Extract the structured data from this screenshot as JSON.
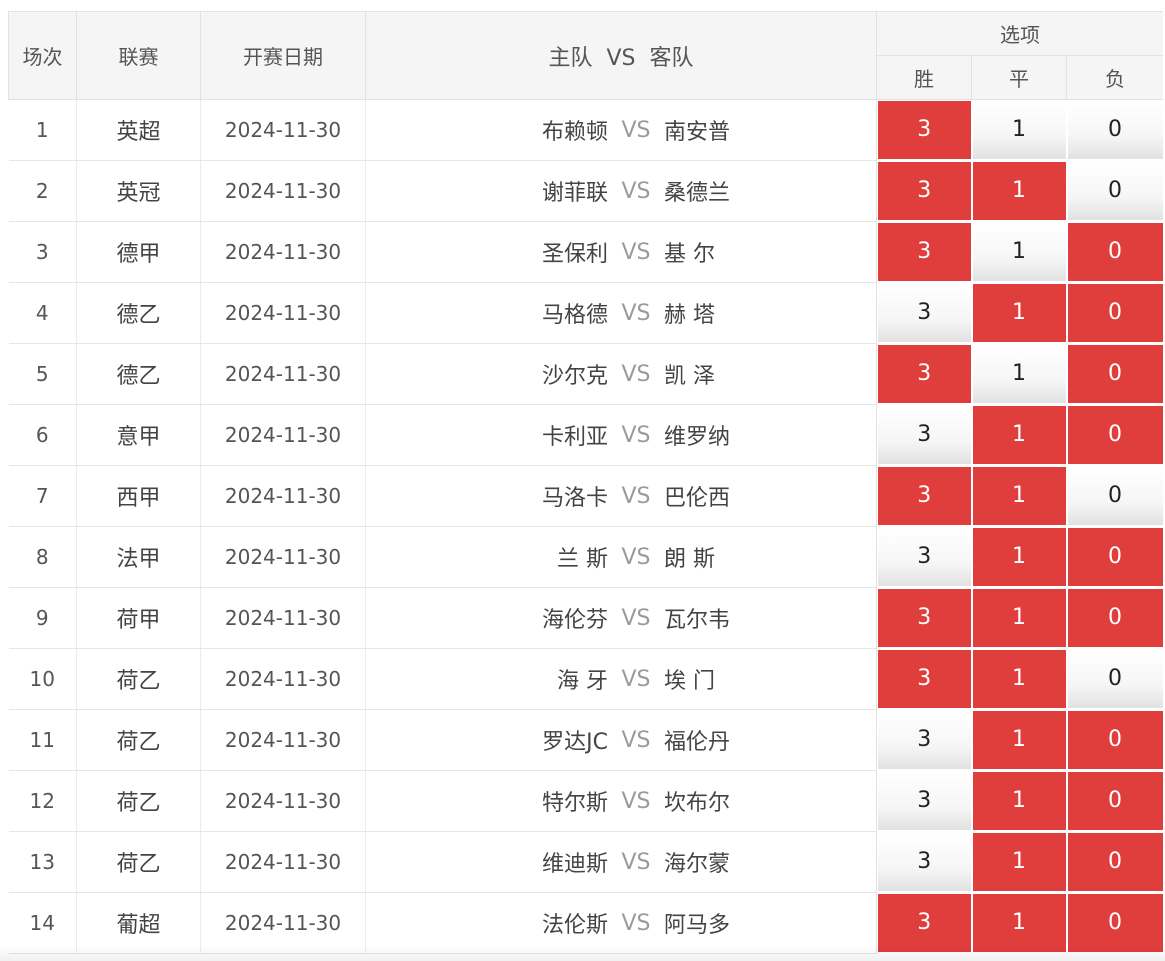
{
  "header": {
    "index": "场次",
    "league": "联赛",
    "date": "开赛日期",
    "home": "主队",
    "vs": "VS",
    "away": "客队",
    "options": "选项",
    "win": "胜",
    "draw": "平",
    "lose": "负"
  },
  "colors": {
    "selected": "#e03d3d",
    "header_bg": "#f5f5f5"
  },
  "matches": [
    {
      "index": "1",
      "league": "英超",
      "date": "2024-11-30",
      "home": "布赖顿",
      "away": "南安普",
      "vs": "VS",
      "win": "3",
      "draw": "1",
      "lose": "0",
      "sel": [
        true,
        false,
        false
      ]
    },
    {
      "index": "2",
      "league": "英冠",
      "date": "2024-11-30",
      "home": "谢菲联",
      "away": "桑德兰",
      "vs": "VS",
      "win": "3",
      "draw": "1",
      "lose": "0",
      "sel": [
        true,
        true,
        false
      ]
    },
    {
      "index": "3",
      "league": "德甲",
      "date": "2024-11-30",
      "home": "圣保利",
      "away": "基 尔",
      "vs": "VS",
      "win": "3",
      "draw": "1",
      "lose": "0",
      "sel": [
        true,
        false,
        true
      ]
    },
    {
      "index": "4",
      "league": "德乙",
      "date": "2024-11-30",
      "home": "马格德",
      "away": "赫 塔",
      "vs": "VS",
      "win": "3",
      "draw": "1",
      "lose": "0",
      "sel": [
        false,
        true,
        true
      ]
    },
    {
      "index": "5",
      "league": "德乙",
      "date": "2024-11-30",
      "home": "沙尔克",
      "away": "凯 泽",
      "vs": "VS",
      "win": "3",
      "draw": "1",
      "lose": "0",
      "sel": [
        true,
        false,
        true
      ]
    },
    {
      "index": "6",
      "league": "意甲",
      "date": "2024-11-30",
      "home": "卡利亚",
      "away": "维罗纳",
      "vs": "VS",
      "win": "3",
      "draw": "1",
      "lose": "0",
      "sel": [
        false,
        true,
        true
      ]
    },
    {
      "index": "7",
      "league": "西甲",
      "date": "2024-11-30",
      "home": "马洛卡",
      "away": "巴伦西",
      "vs": "VS",
      "win": "3",
      "draw": "1",
      "lose": "0",
      "sel": [
        true,
        true,
        false
      ]
    },
    {
      "index": "8",
      "league": "法甲",
      "date": "2024-11-30",
      "home": "兰 斯",
      "away": "朗 斯",
      "vs": "VS",
      "win": "3",
      "draw": "1",
      "lose": "0",
      "sel": [
        false,
        true,
        true
      ]
    },
    {
      "index": "9",
      "league": "荷甲",
      "date": "2024-11-30",
      "home": "海伦芬",
      "away": "瓦尔韦",
      "vs": "VS",
      "win": "3",
      "draw": "1",
      "lose": "0",
      "sel": [
        true,
        true,
        true
      ]
    },
    {
      "index": "10",
      "league": "荷乙",
      "date": "2024-11-30",
      "home": "海 牙",
      "away": "埃 门",
      "vs": "VS",
      "win": "3",
      "draw": "1",
      "lose": "0",
      "sel": [
        true,
        true,
        false
      ]
    },
    {
      "index": "11",
      "league": "荷乙",
      "date": "2024-11-30",
      "home": "罗达JC",
      "away": "福伦丹",
      "vs": "VS",
      "win": "3",
      "draw": "1",
      "lose": "0",
      "sel": [
        false,
        true,
        true
      ]
    },
    {
      "index": "12",
      "league": "荷乙",
      "date": "2024-11-30",
      "home": "特尔斯",
      "away": "坎布尔",
      "vs": "VS",
      "win": "3",
      "draw": "1",
      "lose": "0",
      "sel": [
        false,
        true,
        true
      ]
    },
    {
      "index": "13",
      "league": "荷乙",
      "date": "2024-11-30",
      "home": "维迪斯",
      "away": "海尔蒙",
      "vs": "VS",
      "win": "3",
      "draw": "1",
      "lose": "0",
      "sel": [
        false,
        true,
        true
      ]
    },
    {
      "index": "14",
      "league": "葡超",
      "date": "2024-11-30",
      "home": "法伦斯",
      "away": "阿马多",
      "vs": "VS",
      "win": "3",
      "draw": "1",
      "lose": "0",
      "sel": [
        true,
        true,
        true
      ]
    }
  ]
}
